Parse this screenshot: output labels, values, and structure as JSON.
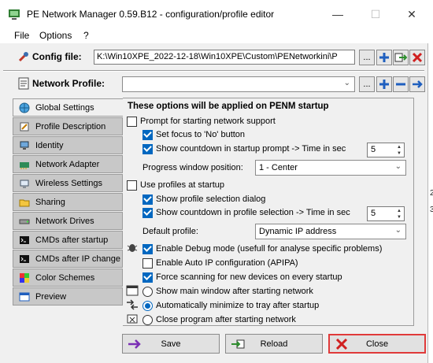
{
  "window": {
    "title": "PE Network Manager 0.59.B12 - configuration/profile editor",
    "minimize": "—",
    "maximize": "☐",
    "close": "✕"
  },
  "menu": {
    "file": "File",
    "options": "Options",
    "help": "?"
  },
  "config": {
    "label": "Config file:",
    "path": "K:\\Win10XPE_2022-12-18\\Win10XPE\\Custom\\PENetworkini\\P",
    "browse": "..."
  },
  "profile": {
    "label": "Network Profile:",
    "value": "",
    "browse": "..."
  },
  "tabs": [
    {
      "label": "Global Settings",
      "icon": "globe-icon"
    },
    {
      "label": "Profile Description",
      "icon": "pencil-icon"
    },
    {
      "label": "Identity",
      "icon": "computer-icon"
    },
    {
      "label": "Network Adapter",
      "icon": "network-card-icon"
    },
    {
      "label": "Wireless Settings",
      "icon": "wireless-icon"
    },
    {
      "label": "Sharing",
      "icon": "folder-share-icon"
    },
    {
      "label": "Network Drives",
      "icon": "network-drive-icon"
    },
    {
      "label": "CMDs after startup",
      "icon": "cmd-icon"
    },
    {
      "label": "CMDs after IP change",
      "icon": "cmd-icon"
    },
    {
      "label": "Color Schemes",
      "icon": "palette-icon"
    },
    {
      "label": "Preview",
      "icon": "preview-icon"
    }
  ],
  "panel": {
    "title": "These options will be applied on PENM startup",
    "prompt_start": "Prompt for starting network support",
    "focus_no": "Set focus to 'No' button",
    "countdown_startup": "Show countdown in startup prompt  ->  Time in sec",
    "countdown_startup_value": "5",
    "progress_label": "Progress window position:",
    "progress_value": "1 - Center",
    "use_profiles": "Use profiles at startup",
    "show_profile_dialog": "Show profile selection dialog",
    "countdown_profile": "Show countdown in profile selection  ->  Time in sec",
    "countdown_profile_value": "5",
    "default_profile_label": "Default profile:",
    "default_profile_value": "Dynamic IP address",
    "debug": "Enable Debug mode (usefull for analyse specific problems)",
    "apipa": "Enable Auto IP configuration (APIPA)",
    "force_scan": "Force scanning for new devices on every startup",
    "show_main": "Show main window after starting network",
    "minimize_tray": "Automatically minimize to tray after startup",
    "close_program": "Close program after starting network"
  },
  "states": {
    "prompt_start": false,
    "focus_no": true,
    "countdown_startup": true,
    "use_profiles": false,
    "show_profile_dialog": true,
    "countdown_profile": true,
    "debug": true,
    "apipa": false,
    "force_scan": true,
    "startup_action": "minimize_tray"
  },
  "buttons": {
    "save": "Save",
    "reload": "Reload",
    "close": "Close"
  },
  "background_fragments": {
    "a": "2",
    "b": "3"
  },
  "colors": {
    "accent": "#0067c0",
    "close_border": "#e03a3a"
  }
}
